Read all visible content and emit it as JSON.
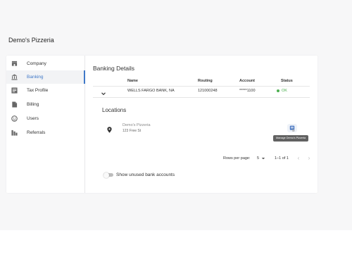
{
  "page": {
    "title": "Demo's Pizzeria"
  },
  "sidebar": {
    "items": [
      {
        "label": "Company",
        "icon": "storefront-icon"
      },
      {
        "label": "Banking",
        "icon": "bank-icon"
      },
      {
        "label": "Tax Profile",
        "icon": "receipt-icon"
      },
      {
        "label": "Billing",
        "icon": "document-icon"
      },
      {
        "label": "Users",
        "icon": "users-icon"
      },
      {
        "label": "Referrals",
        "icon": "referrals-icon"
      }
    ],
    "active": "Banking"
  },
  "banking": {
    "title": "Banking Details",
    "columns": [
      "Name",
      "Routing",
      "Account",
      "Status"
    ],
    "rows": [
      {
        "name": "WELLS FARGO BANK, NA",
        "routing": "121000248",
        "account": "*****1100",
        "status": "OK"
      }
    ]
  },
  "locations": {
    "title": "Locations",
    "items": [
      {
        "name": "Demo's Pizzeria",
        "address": "123 Free St"
      }
    ],
    "manage_tooltip": "Manage Demo's Pizzeria"
  },
  "pagination": {
    "rows_per_page_label": "Rows per page:",
    "rows_per_page": "5",
    "range": "1–1 of 1",
    "prev": "‹",
    "next": "›"
  },
  "toggle": {
    "label": "Show unused bank accounts",
    "checked": false
  },
  "colors": {
    "accent": "#3f78c8",
    "ok": "#4caf50"
  }
}
